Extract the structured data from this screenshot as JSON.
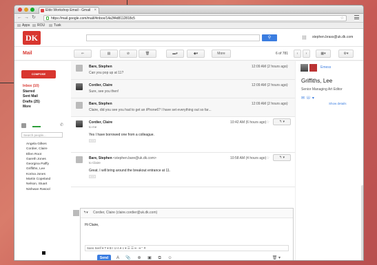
{
  "browser": {
    "tab_title": "Eldo Workshop Email - Gmail",
    "url": "https://mail.google.com/mail/#inbox/14a3f4d8112818c5",
    "bookmarks": [
      "Apps",
      "ROU",
      "Tusk"
    ]
  },
  "header": {
    "logo_text": "DK",
    "user_email": "stephen.brass@uk.dk.com"
  },
  "toolbar": {
    "mail_label": "Mail",
    "more_label": "More",
    "counter": "6 of 781"
  },
  "sidebar": {
    "compose_label": "COMPOSE",
    "nav": [
      {
        "label": "Inbox (10)",
        "active": true
      },
      {
        "label": "Starred",
        "active": false
      },
      {
        "label": "Sent Mail",
        "active": false
      },
      {
        "label": "Drafts (25)",
        "active": false
      },
      {
        "label": "More",
        "active": false
      }
    ],
    "search_placeholder": "Search people...",
    "contacts": [
      "Angela Gilkes",
      "Cordier, Claire",
      "Ellen Root",
      "Gareth Jones",
      "Georgina Palffy",
      "Griffiths, Lee",
      "Korina Jones",
      "Martin Copeland",
      "Nelson, Stuart",
      "Nishwan Rasool"
    ]
  },
  "messages": [
    {
      "sender": "Bare, Stephen",
      "snippet": "Can you pop up at 11?",
      "time": "12:09 AM (2 hours ago)"
    },
    {
      "sender": "Cordier, Claire",
      "snippet": "Sure, see you then!",
      "time": "12:09 AM (2 hours ago)"
    },
    {
      "sender": "Bare, Stephen",
      "snippet": "Claire, did you see you had to get an iPhone6? I have set everything out so far...",
      "time": "12:09 AM (2 hours ago)"
    },
    {
      "sender": "Cordier, Claire",
      "to": "to me",
      "body": "Yes I have borrowed one from a colleague.",
      "time": "10:42 AM (6 hours ago)"
    },
    {
      "sender": "Bare, Stephen",
      "sender_email": "<stephen.bare@uk.dk.com>",
      "to": "to Claire",
      "body": "Great. I will bring around the breakout entrance at 11.",
      "time": "10:58 AM (4 hours ago)"
    }
  ],
  "compose": {
    "to": "Cordier, Claire (claire.cordier@uk.dk.com)",
    "body": "Hi Claire,",
    "format_bar": "Sans Serif  ▾  T  ▾  B  I  U  A  ▾  ≡  ▾  ☰  ☰  ⇤  ⇥  “  ✕",
    "send_label": "Send"
  },
  "right_panel": {
    "tag": "Emess",
    "name": "Griffiths, Lee",
    "title": "Senior Managing Art Editor",
    "details_link": "Show details"
  }
}
